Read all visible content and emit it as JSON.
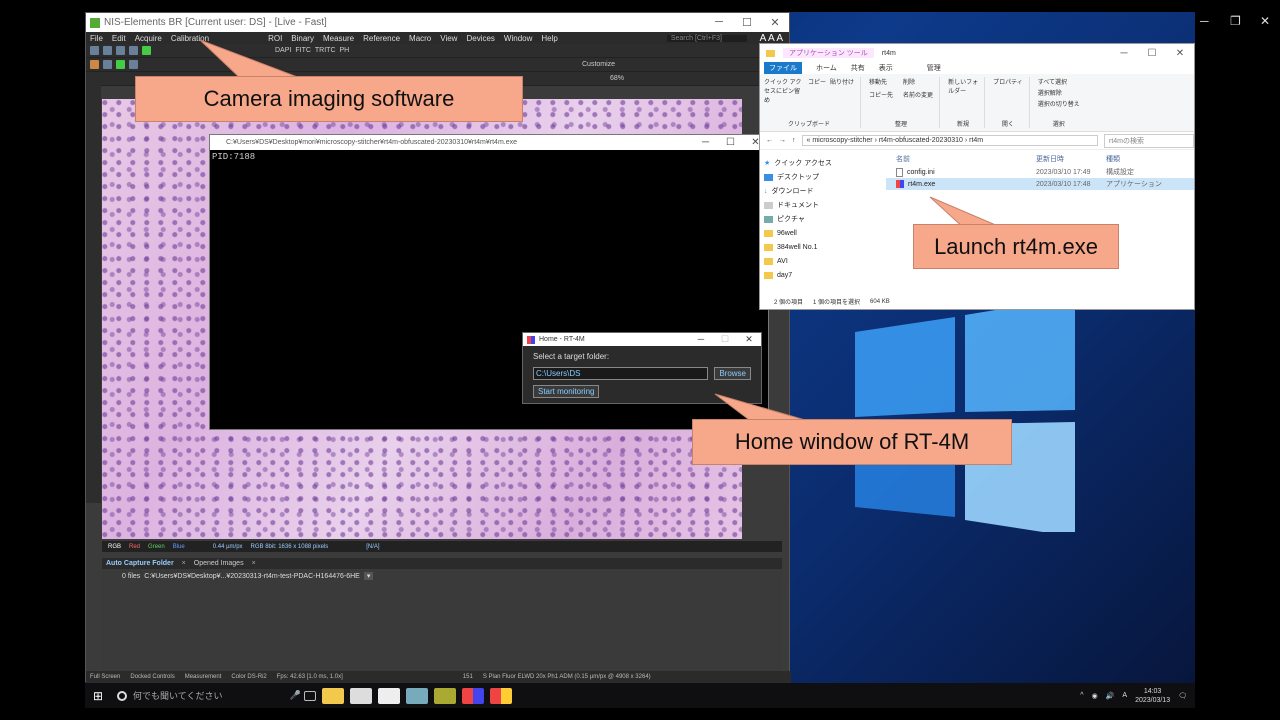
{
  "nis": {
    "title": "NIS-Elements BR [Current user: DS] - [Live - Fast]",
    "menu": [
      "File",
      "Edit",
      "Acquire",
      "Calibration",
      "ROI",
      "Binary",
      "Measure",
      "Reference",
      "Macro",
      "View",
      "Devices",
      "Window",
      "Help"
    ],
    "search_placeholder": "Search [Ctrl+F3]",
    "toolbar_labels": [
      "DAPI",
      "FITC",
      "TRITC",
      "PH"
    ],
    "customize": "Customize",
    "zoom": "68%",
    "status": {
      "rgb": "RGB",
      "red": "Red",
      "green": "Green",
      "blue": "Blue",
      "scale": "0.44 µm/px",
      "format": "RGB 8bit: 1636 x 1088 pixels",
      "na": "[N/A]"
    },
    "panel_tabs": [
      "Auto Capture Folder",
      "Opened Images"
    ],
    "panel_files": "0 files",
    "panel_path": "C:¥Users¥DS¥Desktop¥...¥20230313-rt4m-test-PDAC-H164476-6HE",
    "bottom": [
      "Full Screen",
      "Docked Controls",
      "Measurement",
      "Color DS-Ri2",
      "Fps: 42.63 [1.0 ms, 1.0x]",
      "151",
      "S Plan Fluor ELWD 20x Ph1 ADM (0.15 µm/px @ 4908 x 3264)"
    ]
  },
  "console": {
    "title": "C:¥Users¥DS¥Desktop¥mori¥microscopy-stitcher¥rt4m-obfuscated-20230310¥rt4m¥rt4m.exe",
    "pid": "PID:7188"
  },
  "explorer": {
    "tools_tab": "アプリケーション ツール",
    "title": "rt4m",
    "tabs": [
      "ファイル",
      "ホーム",
      "共有",
      "表示",
      "管理"
    ],
    "ribbon": {
      "clipboard": [
        "クイック アクセスにピン留め",
        "コピー",
        "貼り付け"
      ],
      "clipboard_group": "クリップボード",
      "organize": [
        "移動先",
        "削除",
        "コピー先",
        "名前の変更"
      ],
      "organize_group": "整理",
      "new": [
        "新しいフォルダー"
      ],
      "new_group": "新規",
      "open": [
        "プロパティ"
      ],
      "open_group": "開く",
      "select": [
        "すべて選択",
        "選択解除",
        "選択の切り替え"
      ],
      "select_group": "選択"
    },
    "breadcrumb": "« microscopy-stitcher › rt4m-obfuscated-20230310 › rt4m",
    "search": "rt4mの検索",
    "nav": [
      "クイック アクセス",
      "デスクトップ",
      "ダウンロード",
      "ドキュメント",
      "ピクチャ",
      "96well",
      "384well No.1",
      "AVI",
      "day7"
    ],
    "columns": [
      "名前",
      "更新日時",
      "種類"
    ],
    "files": [
      {
        "name": "config.ini",
        "date": "2023/03/10 17:49",
        "type": "構成設定"
      },
      {
        "name": "rt4m.exe",
        "date": "2023/03/10 17:48",
        "type": "アプリケーション"
      }
    ],
    "status": [
      "2 個の項目",
      "1 個の項目を選択",
      "604 KB"
    ]
  },
  "home": {
    "title": "Home - RT-4M",
    "prompt": "Select a target folder:",
    "folder_value": "C:\\Users\\DS",
    "browse": "Browse",
    "start": "Start monitoring"
  },
  "callouts": {
    "camera": "Camera imaging software",
    "launch": "Launch rt4m.exe",
    "home": "Home window of RT-4M"
  },
  "taskbar": {
    "search": "何でも聞いてください",
    "time": "14:03",
    "date": "2023/03/13"
  }
}
